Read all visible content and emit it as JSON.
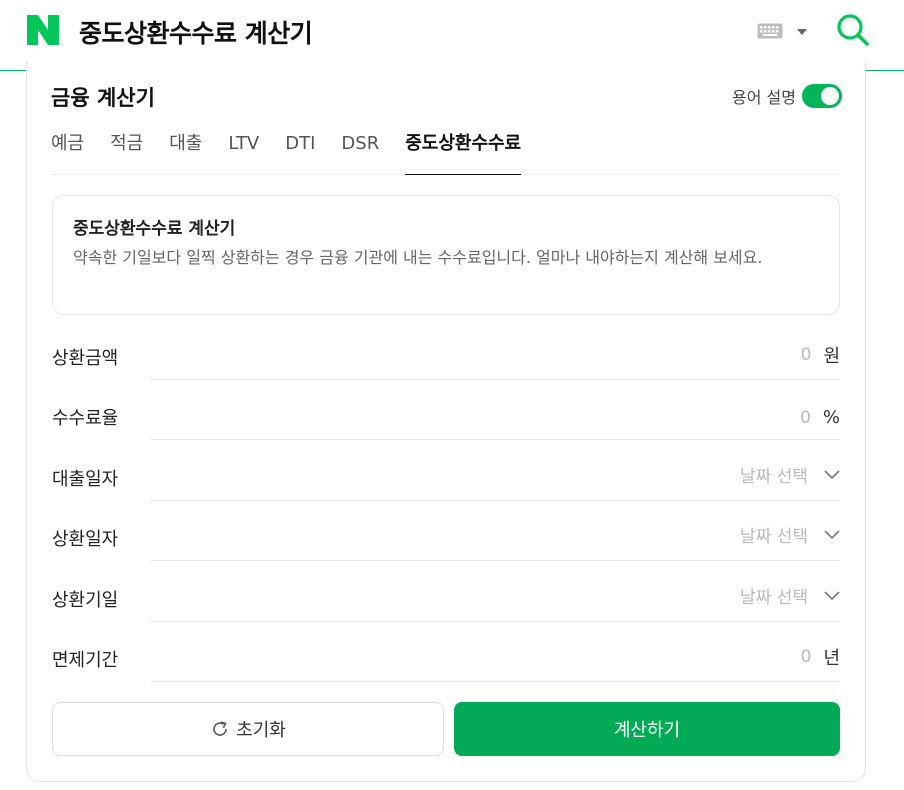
{
  "header": {
    "logo": "N",
    "title": "중도상환수수료 계산기",
    "keyboard_icon": "keyboard-icon",
    "search_icon": "search-icon"
  },
  "section": {
    "title": "금융 계산기",
    "glossary_label": "용어 설명",
    "glossary_on": true
  },
  "tabs": [
    {
      "label": "예금",
      "active": false
    },
    {
      "label": "적금",
      "active": false
    },
    {
      "label": "대출",
      "active": false
    },
    {
      "label": "LTV",
      "active": false
    },
    {
      "label": "DTI",
      "active": false
    },
    {
      "label": "DSR",
      "active": false
    },
    {
      "label": "중도상환수수료",
      "active": true
    }
  ],
  "info": {
    "title": "중도상환수수료 계산기",
    "description": "약속한 기일보다 일찍 상환하는 경우 금융 기관에 내는 수수료입니다. 얼마나 내야하는지 계산해 보세요."
  },
  "fields": {
    "repay_amount": {
      "label": "상환금액",
      "value": "0",
      "unit": "원"
    },
    "fee_rate": {
      "label": "수수료율",
      "value": "0",
      "unit": "%"
    },
    "loan_date": {
      "label": "대출일자",
      "placeholder": "날짜 선택"
    },
    "repay_date": {
      "label": "상환일자",
      "placeholder": "날짜 선택"
    },
    "due_date": {
      "label": "상환기일",
      "placeholder": "날짜 선택"
    },
    "exempt_period": {
      "label": "면제기간",
      "value": "0",
      "unit": "년"
    }
  },
  "buttons": {
    "reset": "초기화",
    "calculate": "계산하기"
  },
  "colors": {
    "brand": "#03b55a",
    "button": "#03aa56"
  }
}
